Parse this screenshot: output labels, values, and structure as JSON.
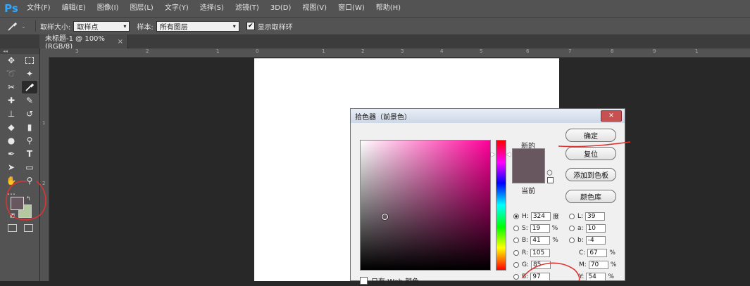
{
  "app": {
    "logo": "Ps"
  },
  "menu": [
    "文件(F)",
    "编辑(E)",
    "图像(I)",
    "图层(L)",
    "文字(Y)",
    "选择(S)",
    "滤镜(T)",
    "3D(D)",
    "视图(V)",
    "窗口(W)",
    "帮助(H)"
  ],
  "options": {
    "sample_size_label": "取样大小:",
    "sample_size_value": "取样点",
    "sample_label": "样本:",
    "sample_value": "所有图层",
    "show_ring_label": "显示取样环",
    "show_ring_checked": true
  },
  "document": {
    "tab_title": "未标题-1 @ 100%(RGB/8)"
  },
  "rulers": {
    "top": [
      "3",
      "2",
      "1",
      "0",
      "1",
      "2",
      "3",
      "4",
      "5",
      "6",
      "7",
      "8",
      "9",
      "1"
    ],
    "left": [
      "1",
      "2"
    ]
  },
  "dialog": {
    "title": "拾色器（前景色）",
    "new_label": "新的",
    "current_label": "当前",
    "new_color": "#695760",
    "buttons": {
      "ok": "确定",
      "reset": "复位",
      "add_swatch": "添加到色板",
      "color_lib": "颜色库"
    },
    "hsb": [
      {
        "label": "H:",
        "value": "324",
        "unit": "度",
        "selected": true
      },
      {
        "label": "S:",
        "value": "19",
        "unit": "%"
      },
      {
        "label": "B:",
        "value": "41",
        "unit": "%"
      }
    ],
    "lab": [
      {
        "label": "L:",
        "value": "39"
      },
      {
        "label": "a:",
        "value": "10"
      },
      {
        "label": "b:",
        "value": "-4"
      }
    ],
    "rgb": [
      {
        "label": "R:",
        "value": "105"
      },
      {
        "label": "G:",
        "value": "85"
      },
      {
        "label": "B:",
        "value": "97"
      }
    ],
    "cmyk": [
      {
        "label": "C:",
        "value": "67",
        "unit": "%"
      },
      {
        "label": "M:",
        "value": "70",
        "unit": "%"
      },
      {
        "label": "Y:",
        "value": "54",
        "unit": "%"
      }
    ],
    "web_only_label": "只有 Web 颜色"
  },
  "colors": {
    "foreground": "#695760",
    "background": "#b5c9a0",
    "annotation": "#d33"
  }
}
